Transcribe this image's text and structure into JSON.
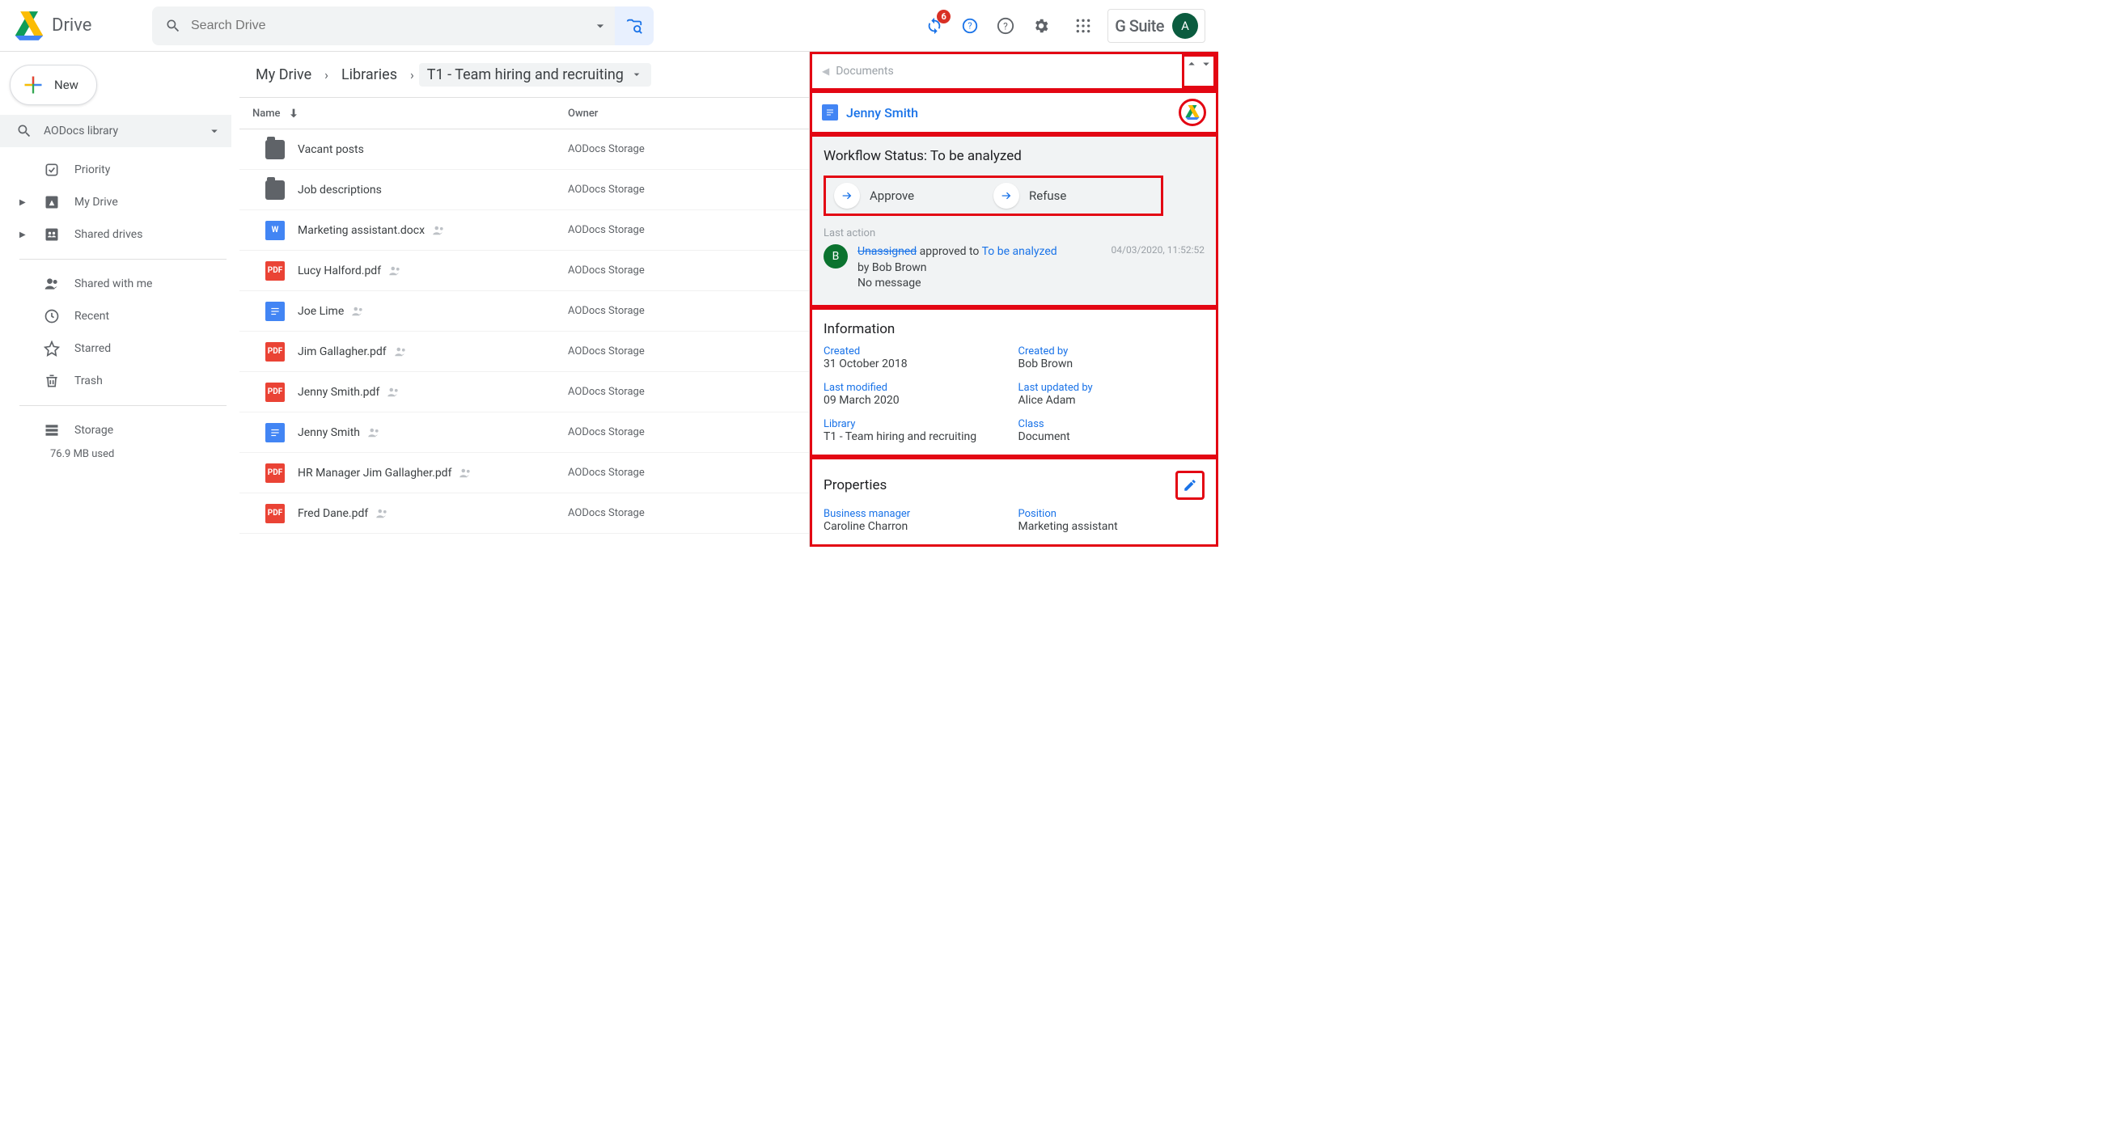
{
  "header": {
    "product": "Drive",
    "search_placeholder": "Search Drive",
    "notif_count": "6",
    "workspace_brand": "G Suite",
    "account_initial": "A"
  },
  "sidebar": {
    "new_label": "New",
    "aodocs_dropdown": "AODocs library",
    "items": {
      "priority": "Priority",
      "mydrive": "My Drive",
      "shared_drives": "Shared drives",
      "shared_with_me": "Shared with me",
      "recent": "Recent",
      "starred": "Starred",
      "trash": "Trash",
      "storage": "Storage"
    },
    "storage_used": "76.9 MB used"
  },
  "breadcrumbs": [
    "My Drive",
    "Libraries",
    "T1 - Team hiring and recruiting"
  ],
  "list": {
    "col_name": "Name",
    "col_owner": "Owner",
    "rows": [
      {
        "icon": "folder",
        "name": "Vacant posts",
        "shared": false,
        "owner": "AODocs Storage"
      },
      {
        "icon": "folder",
        "name": "Job descriptions",
        "shared": false,
        "owner": "AODocs Storage"
      },
      {
        "icon": "docx",
        "name": "Marketing assistant.docx",
        "shared": true,
        "owner": "AODocs Storage"
      },
      {
        "icon": "pdf",
        "name": "Lucy Halford.pdf",
        "shared": true,
        "owner": "AODocs Storage"
      },
      {
        "icon": "gdoc",
        "name": "Joe Lime",
        "shared": true,
        "owner": "AODocs Storage"
      },
      {
        "icon": "pdf",
        "name": "Jim Gallagher.pdf",
        "shared": true,
        "owner": "AODocs Storage"
      },
      {
        "icon": "pdf",
        "name": "Jenny Smith.pdf",
        "shared": true,
        "owner": "AODocs Storage"
      },
      {
        "icon": "gdoc",
        "name": "Jenny Smith",
        "shared": true,
        "owner": "AODocs Storage"
      },
      {
        "icon": "pdf",
        "name": "HR Manager Jim Gallagher.pdf",
        "shared": true,
        "owner": "AODocs Storage"
      },
      {
        "icon": "pdf",
        "name": "Fred Dane.pdf",
        "shared": true,
        "owner": "AODocs Storage"
      }
    ]
  },
  "panel": {
    "tab": "Documents",
    "doc_title": "Jenny Smith",
    "workflow": {
      "status_label": "Workflow Status: ",
      "status_value": "To be analyzed",
      "approve": "Approve",
      "refuse": "Refuse"
    },
    "last_action": {
      "label": "Last action",
      "timestamp": "04/03/2020, 11:52:52",
      "actor_initial": "B",
      "from_state": "Unassigned",
      "verb": " approved to ",
      "to_state": "To be analyzed",
      "by_prefix": "by ",
      "by": "Bob Brown",
      "message": "No message"
    },
    "info": {
      "heading": "Information",
      "created_l": "Created",
      "created_v": "31 October 2018",
      "created_by_l": "Created by",
      "created_by_v": "Bob Brown",
      "modified_l": "Last modified",
      "modified_v": "09 March 2020",
      "updated_by_l": "Last updated by",
      "updated_by_v": "Alice Adam",
      "library_l": "Library",
      "library_v": "T1 - Team hiring and recruiting",
      "class_l": "Class",
      "class_v": "Document"
    },
    "props": {
      "heading": "Properties",
      "bm_l": "Business manager",
      "bm_v": "Caroline Charron",
      "pos_l": "Position",
      "pos_v": "Marketing assistant"
    }
  }
}
